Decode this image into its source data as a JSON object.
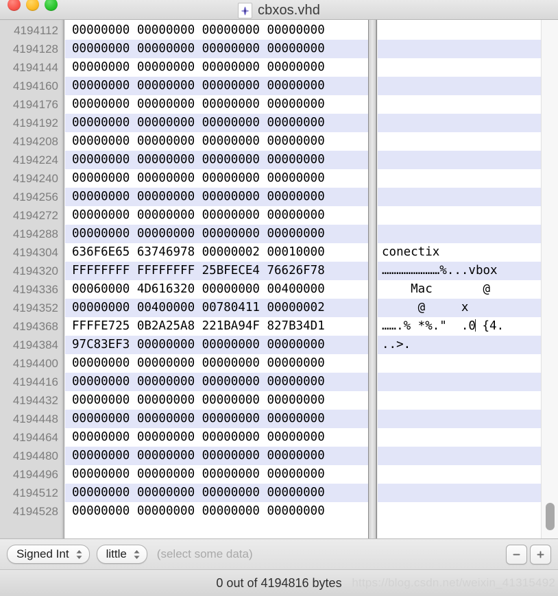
{
  "window": {
    "title": "cbxos.vhd",
    "doc_icon": "vhd-file-icon",
    "traffic_lights": {
      "close": "close-button",
      "minimize": "minimize-button",
      "maximize": "maximize-button"
    }
  },
  "hex_view": {
    "bytes_per_row": 16,
    "group_size_bytes": 4,
    "rows": [
      {
        "address": "4194112",
        "hex": "00000000 00000000 00000000 00000000",
        "ascii": ""
      },
      {
        "address": "4194128",
        "hex": "00000000 00000000 00000000 00000000",
        "ascii": ""
      },
      {
        "address": "4194144",
        "hex": "00000000 00000000 00000000 00000000",
        "ascii": ""
      },
      {
        "address": "4194160",
        "hex": "00000000 00000000 00000000 00000000",
        "ascii": ""
      },
      {
        "address": "4194176",
        "hex": "00000000 00000000 00000000 00000000",
        "ascii": ""
      },
      {
        "address": "4194192",
        "hex": "00000000 00000000 00000000 00000000",
        "ascii": ""
      },
      {
        "address": "4194208",
        "hex": "00000000 00000000 00000000 00000000",
        "ascii": ""
      },
      {
        "address": "4194224",
        "hex": "00000000 00000000 00000000 00000000",
        "ascii": ""
      },
      {
        "address": "4194240",
        "hex": "00000000 00000000 00000000 00000000",
        "ascii": ""
      },
      {
        "address": "4194256",
        "hex": "00000000 00000000 00000000 00000000",
        "ascii": ""
      },
      {
        "address": "4194272",
        "hex": "00000000 00000000 00000000 00000000",
        "ascii": ""
      },
      {
        "address": "4194288",
        "hex": "00000000 00000000 00000000 00000000",
        "ascii": ""
      },
      {
        "address": "4194304",
        "hex": "636F6E65 63746978 00000002 00010000",
        "ascii": "conectix"
      },
      {
        "address": "4194320",
        "hex": "FFFFFFFF FFFFFFFF 25BFECE4 76626F78",
        "ascii": "……………………%...vbox"
      },
      {
        "address": "4194336",
        "hex": "00060000 4D616320 00000000 00400000",
        "ascii": "    Mac       @"
      },
      {
        "address": "4194352",
        "hex": "00000000 00400000 00780411 00000002",
        "ascii": "     @     x"
      },
      {
        "address": "4194368",
        "hex": "FFFFE725 0B2A25A8 221BA94F 827B34D1",
        "ascii": "…….% *%.\"  .0| {4."
      },
      {
        "address": "4194384",
        "hex": "97C83EF3 00000000 00000000 00000000",
        "ascii": "..>."
      },
      {
        "address": "4194400",
        "hex": "00000000 00000000 00000000 00000000",
        "ascii": ""
      },
      {
        "address": "4194416",
        "hex": "00000000 00000000 00000000 00000000",
        "ascii": ""
      },
      {
        "address": "4194432",
        "hex": "00000000 00000000 00000000 00000000",
        "ascii": ""
      },
      {
        "address": "4194448",
        "hex": "00000000 00000000 00000000 00000000",
        "ascii": ""
      },
      {
        "address": "4194464",
        "hex": "00000000 00000000 00000000 00000000",
        "ascii": ""
      },
      {
        "address": "4194480",
        "hex": "00000000 00000000 00000000 00000000",
        "ascii": ""
      },
      {
        "address": "4194496",
        "hex": "00000000 00000000 00000000 00000000",
        "ascii": ""
      },
      {
        "address": "4194512",
        "hex": "00000000 00000000 00000000 00000000",
        "ascii": ""
      },
      {
        "address": "4194528",
        "hex": "00000000 00000000 00000000 00000000",
        "ascii": ""
      }
    ]
  },
  "inspector": {
    "type_popup": {
      "value": "Signed Int",
      "icon": "chevron-updown-icon"
    },
    "endian_popup": {
      "value": "little",
      "icon": "chevron-updown-icon"
    },
    "hint": "(select some data)",
    "minus_button": "−",
    "plus_button": "+"
  },
  "status": {
    "text": "0 out of 4194816 bytes",
    "watermark": "https://blog.csdn.net/weixin_41315492"
  },
  "colors": {
    "row_alt": "#e2e5f8",
    "gutter_bg": "#d9d9d9",
    "address_text": "#7d7d7d",
    "chrome": "#dedede"
  }
}
